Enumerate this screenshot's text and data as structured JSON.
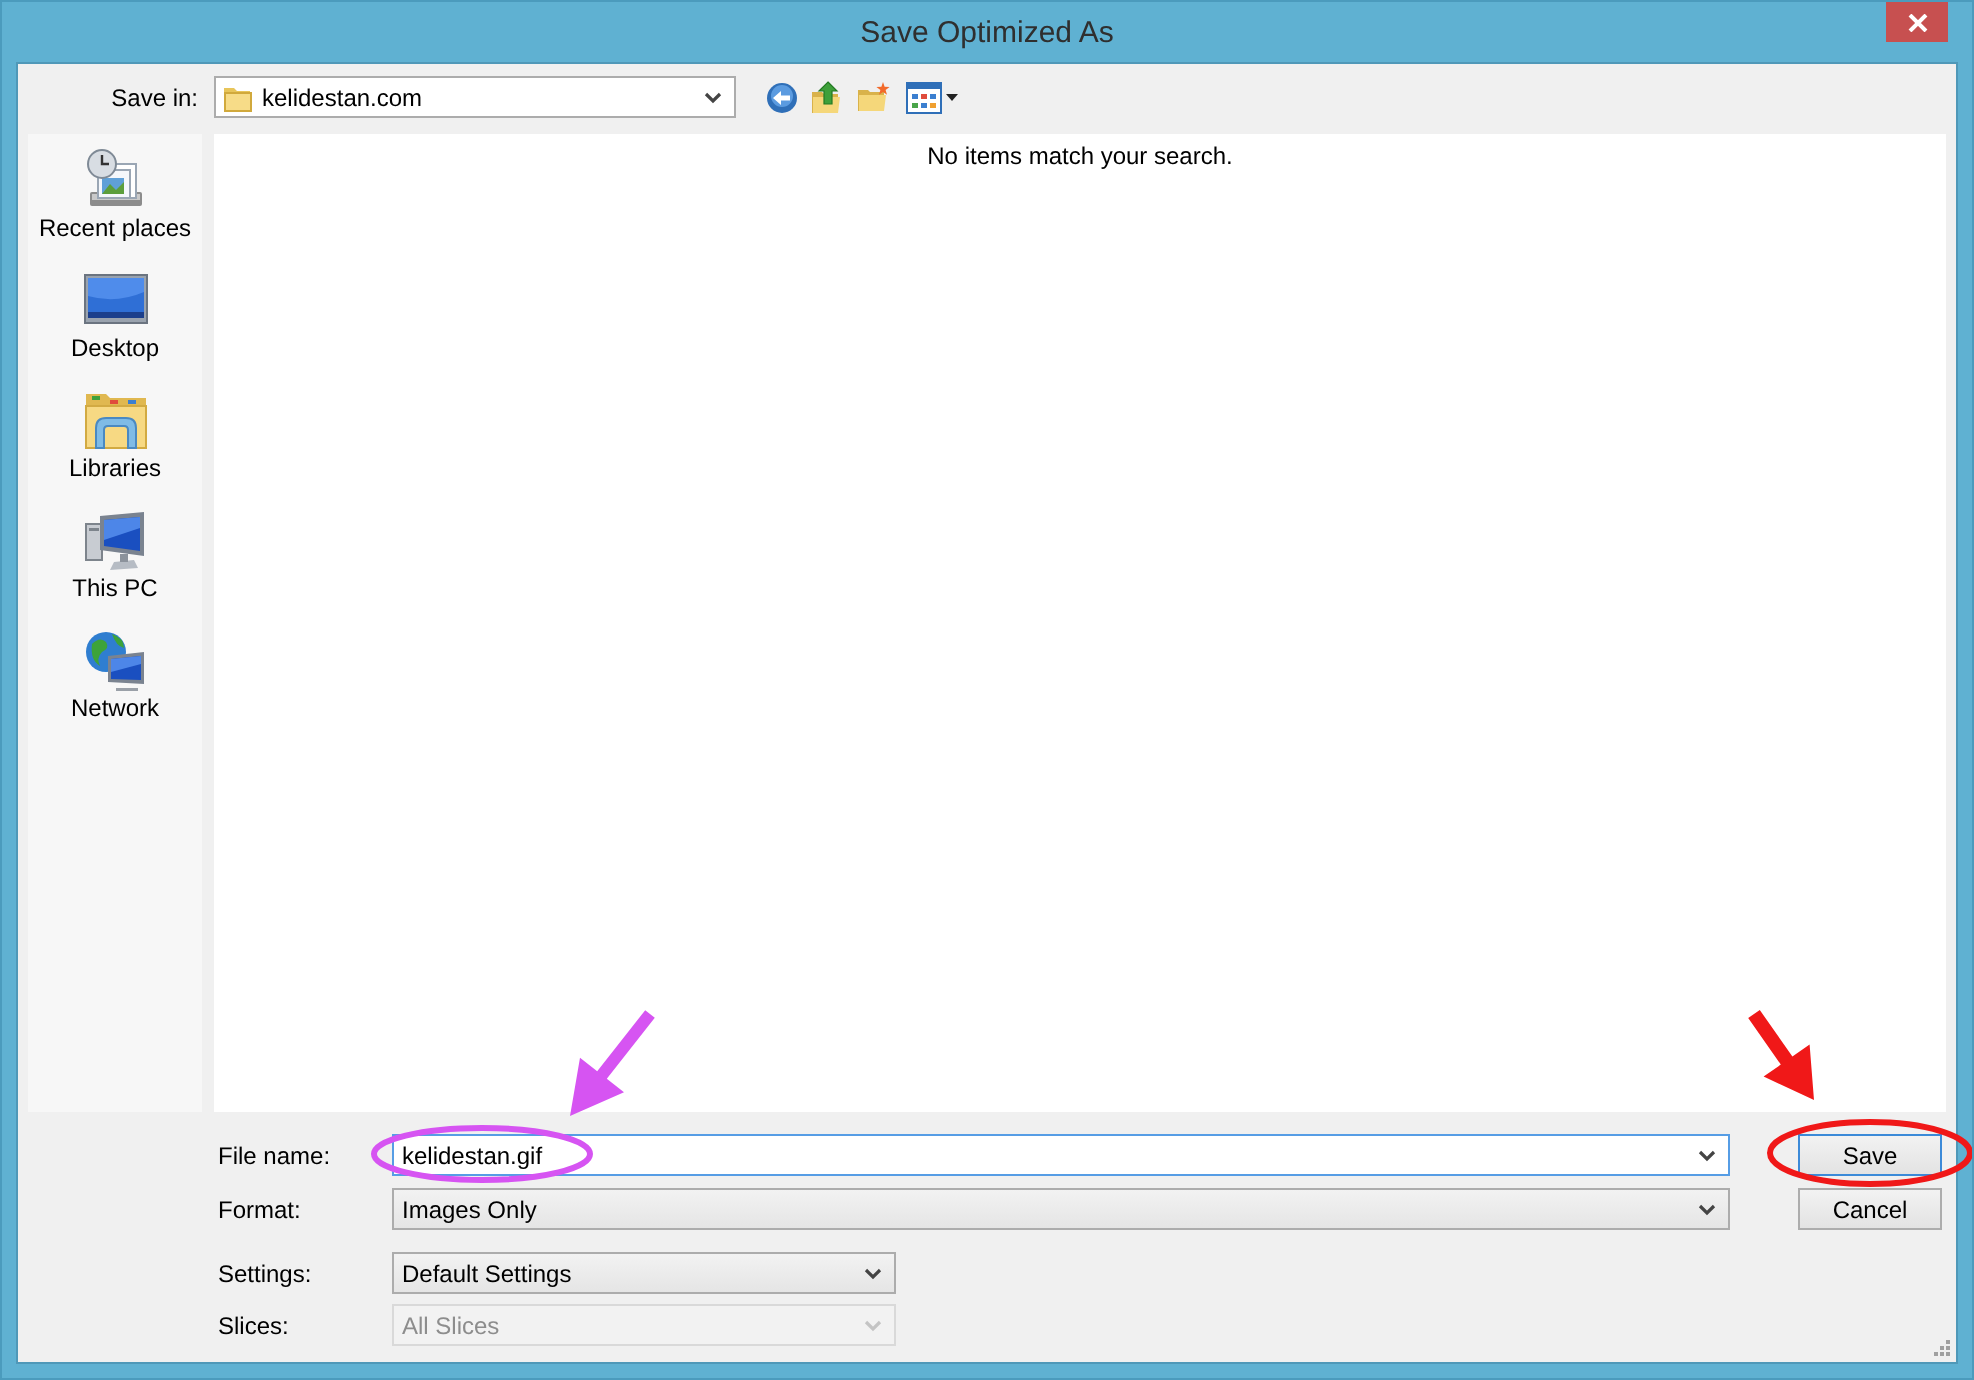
{
  "window": {
    "title": "Save Optimized As"
  },
  "save_in": {
    "label": "Save in:",
    "value": "kelidestan.com"
  },
  "places": [
    {
      "kind": "recent",
      "label": "Recent places"
    },
    {
      "kind": "desktop",
      "label": "Desktop"
    },
    {
      "kind": "libraries",
      "label": "Libraries"
    },
    {
      "kind": "pc",
      "label": "This PC"
    },
    {
      "kind": "network",
      "label": "Network"
    }
  ],
  "file_list": {
    "message": "No items match your search."
  },
  "file_fields": [
    {
      "kind": "editable",
      "label": "File name:",
      "value": "kelidestan.gif",
      "focused": true
    },
    {
      "kind": "dropdown",
      "label": "Format:",
      "value": "Images Only",
      "focused": false
    }
  ],
  "buttons": [
    {
      "label": "Save",
      "default": true
    },
    {
      "label": "Cancel",
      "default": false
    }
  ],
  "options": [
    {
      "label": "Settings:",
      "value": "Default Settings",
      "disabled": false
    },
    {
      "label": "Slices:",
      "value": "All Slices",
      "disabled": true
    }
  ],
  "annotations": [
    {
      "kind": "field",
      "color": "#d654f2"
    },
    {
      "kind": "button",
      "color": "#f01818"
    }
  ]
}
